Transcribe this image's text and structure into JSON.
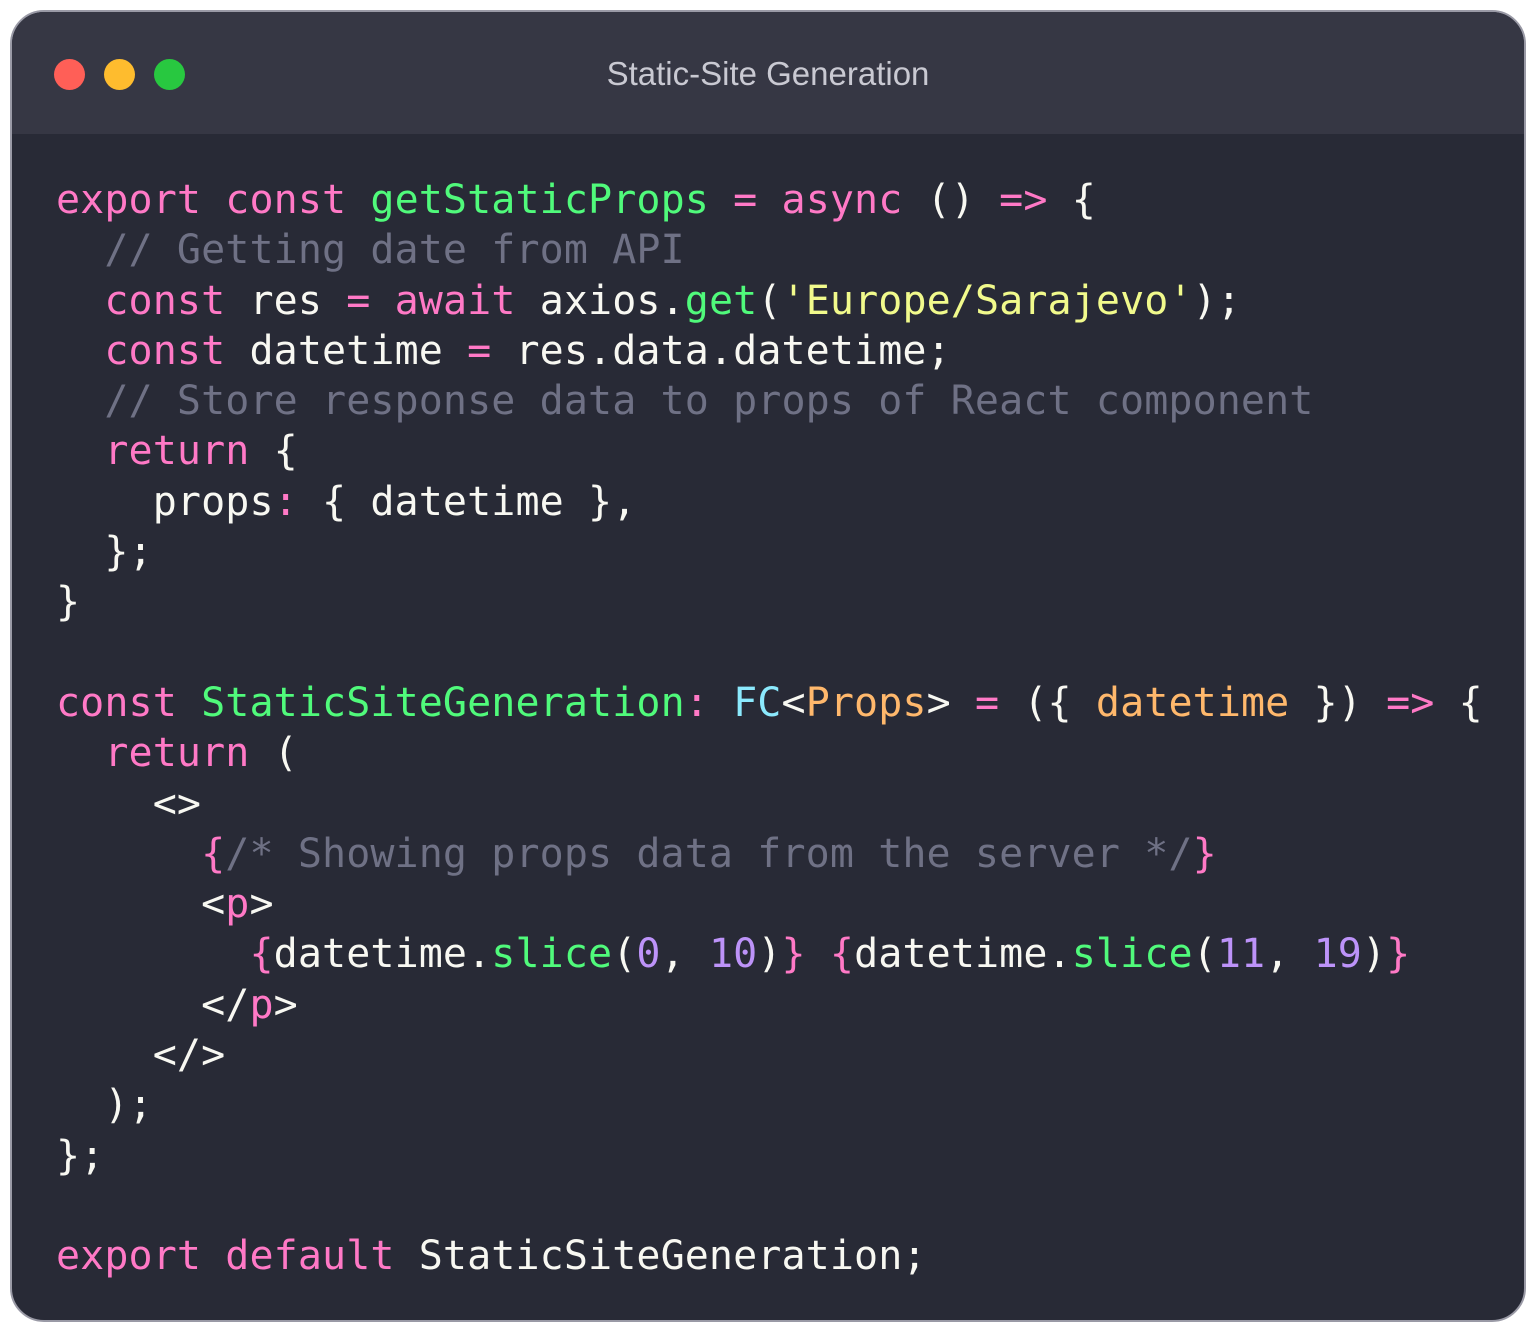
{
  "window": {
    "title": "Static-Site Generation",
    "traffic_lights": [
      {
        "name": "close",
        "color": "#ff5f57"
      },
      {
        "name": "minimize",
        "color": "#febc2e"
      },
      {
        "name": "zoom",
        "color": "#28c840"
      }
    ]
  },
  "colors": {
    "keyword": "#ff79c6",
    "function": "#50fa7b",
    "comment": "#6f7185",
    "string": "#f1fa8c",
    "type": "#8be9fd",
    "param": "#ffb86c",
    "number": "#bd93f9",
    "plain": "#f8f8f2"
  },
  "code_lines": [
    [
      [
        "keyword",
        "export"
      ],
      [
        "plain",
        " "
      ],
      [
        "keyword",
        "const"
      ],
      [
        "plain",
        " "
      ],
      [
        "function",
        "getStaticProps"
      ],
      [
        "plain",
        " "
      ],
      [
        "keyword",
        "="
      ],
      [
        "plain",
        " "
      ],
      [
        "keyword",
        "async"
      ],
      [
        "plain",
        " () "
      ],
      [
        "keyword",
        "=>"
      ],
      [
        "plain",
        " {"
      ]
    ],
    [
      [
        "plain",
        "  "
      ],
      [
        "comment",
        "// Getting date from API"
      ]
    ],
    [
      [
        "plain",
        "  "
      ],
      [
        "keyword",
        "const"
      ],
      [
        "plain",
        " res "
      ],
      [
        "keyword",
        "="
      ],
      [
        "plain",
        " "
      ],
      [
        "keyword",
        "await"
      ],
      [
        "plain",
        " axios."
      ],
      [
        "function",
        "get"
      ],
      [
        "plain",
        "("
      ],
      [
        "string",
        "'Europe/Sarajevo'"
      ],
      [
        "plain",
        ");"
      ]
    ],
    [
      [
        "plain",
        "  "
      ],
      [
        "keyword",
        "const"
      ],
      [
        "plain",
        " datetime "
      ],
      [
        "keyword",
        "="
      ],
      [
        "plain",
        " res.data.datetime;"
      ]
    ],
    [
      [
        "plain",
        "  "
      ],
      [
        "comment",
        "// Store response data to props of React component"
      ]
    ],
    [
      [
        "plain",
        "  "
      ],
      [
        "keyword",
        "return"
      ],
      [
        "plain",
        " {"
      ]
    ],
    [
      [
        "plain",
        "    props"
      ],
      [
        "keyword",
        ":"
      ],
      [
        "plain",
        " { datetime },"
      ]
    ],
    [
      [
        "plain",
        "  };"
      ]
    ],
    [
      [
        "plain",
        "}"
      ]
    ],
    [],
    [
      [
        "keyword",
        "const"
      ],
      [
        "plain",
        " "
      ],
      [
        "function",
        "StaticSiteGeneration"
      ],
      [
        "keyword",
        ":"
      ],
      [
        "plain",
        " "
      ],
      [
        "type",
        "FC"
      ],
      [
        "plain",
        "<"
      ],
      [
        "param",
        "Props"
      ],
      [
        "plain",
        "> "
      ],
      [
        "keyword",
        "="
      ],
      [
        "plain",
        " ({ "
      ],
      [
        "param",
        "datetime"
      ],
      [
        "plain",
        " }) "
      ],
      [
        "keyword",
        "=>"
      ],
      [
        "plain",
        " {"
      ]
    ],
    [
      [
        "plain",
        "  "
      ],
      [
        "keyword",
        "return"
      ],
      [
        "plain",
        " ("
      ]
    ],
    [
      [
        "plain",
        "    <>"
      ]
    ],
    [
      [
        "plain",
        "      "
      ],
      [
        "keyword",
        "{"
      ],
      [
        "comment",
        "/* Showing props data from the server */"
      ],
      [
        "keyword",
        "}"
      ]
    ],
    [
      [
        "plain",
        "      <"
      ],
      [
        "keyword",
        "p"
      ],
      [
        "plain",
        ">"
      ]
    ],
    [
      [
        "plain",
        "        "
      ],
      [
        "keyword",
        "{"
      ],
      [
        "plain",
        "datetime."
      ],
      [
        "function",
        "slice"
      ],
      [
        "plain",
        "("
      ],
      [
        "number",
        "0"
      ],
      [
        "plain",
        ", "
      ],
      [
        "number",
        "10"
      ],
      [
        "plain",
        ")"
      ],
      [
        "keyword",
        "}"
      ],
      [
        "plain",
        " "
      ],
      [
        "keyword",
        "{"
      ],
      [
        "plain",
        "datetime."
      ],
      [
        "function",
        "slice"
      ],
      [
        "plain",
        "("
      ],
      [
        "number",
        "11"
      ],
      [
        "plain",
        ", "
      ],
      [
        "number",
        "19"
      ],
      [
        "plain",
        ")"
      ],
      [
        "keyword",
        "}"
      ]
    ],
    [
      [
        "plain",
        "      </"
      ],
      [
        "keyword",
        "p"
      ],
      [
        "plain",
        ">"
      ]
    ],
    [
      [
        "plain",
        "    </>"
      ]
    ],
    [
      [
        "plain",
        "  );"
      ]
    ],
    [
      [
        "plain",
        "};"
      ]
    ],
    [],
    [
      [
        "keyword",
        "export"
      ],
      [
        "plain",
        " "
      ],
      [
        "keyword",
        "default"
      ],
      [
        "plain",
        " StaticSiteGeneration;"
      ]
    ]
  ]
}
